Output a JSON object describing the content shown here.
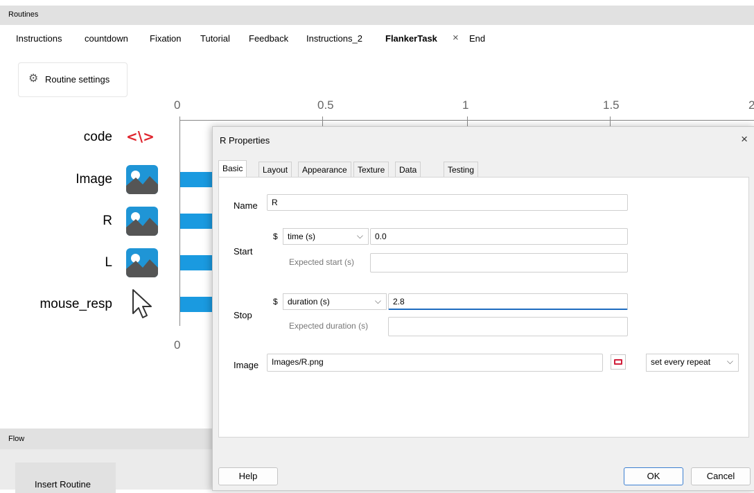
{
  "routines_header": "Routines",
  "tabs": [
    {
      "label": "Instructions"
    },
    {
      "label": "countdown"
    },
    {
      "label": "Fixation"
    },
    {
      "label": "Tutorial"
    },
    {
      "label": "Feedback"
    },
    {
      "label": "Instructions_2"
    },
    {
      "label": "FlankerTask"
    },
    {
      "label": "End"
    }
  ],
  "tab_close_glyph": "×",
  "routine_settings_label": "Routine settings",
  "timeline": {
    "ticks": [
      "0",
      "0.5",
      "1",
      "1.5",
      "2"
    ],
    "bottom_tick": "0",
    "components": [
      {
        "name": "code",
        "icon": "code-icon"
      },
      {
        "name": "Image",
        "icon": "image-icon"
      },
      {
        "name": "R",
        "icon": "image-icon"
      },
      {
        "name": "L",
        "icon": "image-icon"
      },
      {
        "name": "mouse_resp",
        "icon": "mouse-cursor-icon"
      }
    ],
    "bar_color": "#1a9ae0"
  },
  "flow": {
    "header": "Flow",
    "insert_routine_label": "Insert Routine"
  },
  "dialog": {
    "title": "R Properties",
    "close_glyph": "×",
    "tabs": [
      "Basic",
      "Layout",
      "Appearance",
      "Texture",
      "Data",
      "Testing"
    ],
    "active_tab": "Basic",
    "fields": {
      "name_label": "Name",
      "name_value": "R",
      "start_label": "Start",
      "start_type": "time (s)",
      "start_value": "0.0",
      "expected_start_label": "Expected start (s)",
      "expected_start_value": "",
      "stop_label": "Stop",
      "stop_type": "duration (s)",
      "stop_value": "2.8",
      "expected_duration_label": "Expected duration (s)",
      "expected_duration_value": "",
      "image_label": "Image",
      "image_value": "Images/R.png",
      "image_update": "set every repeat",
      "dollar": "$"
    },
    "buttons": {
      "help": "Help",
      "ok": "OK",
      "cancel": "Cancel"
    }
  }
}
